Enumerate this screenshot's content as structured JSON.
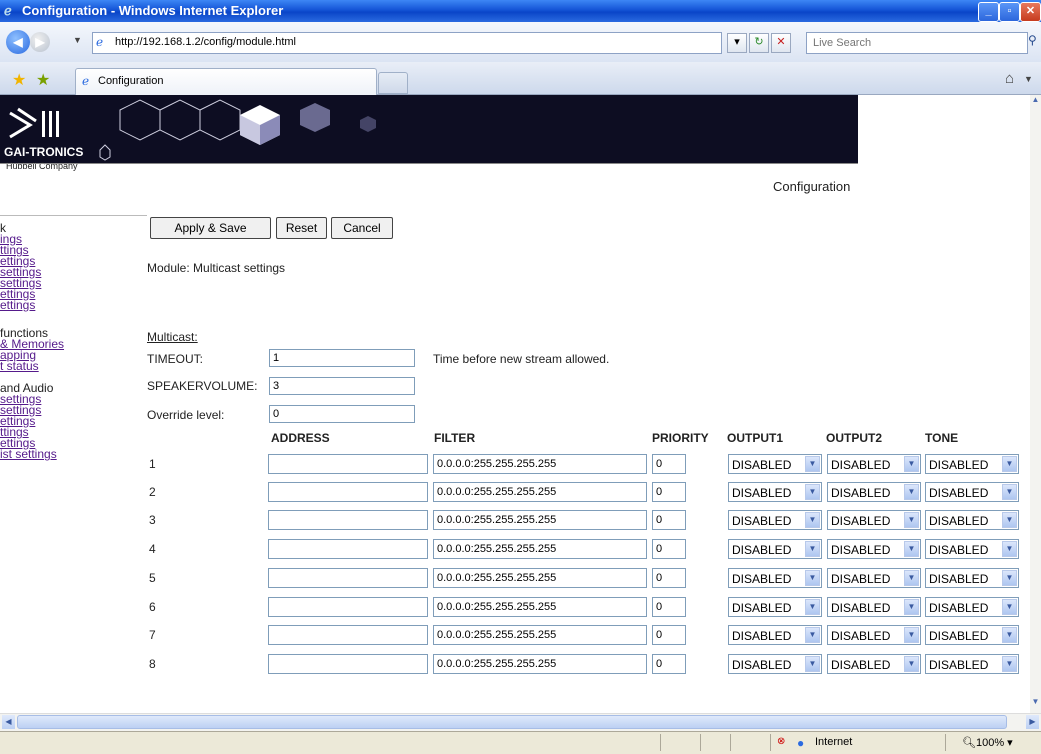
{
  "window": {
    "title": "Configuration - Windows Internet Explorer",
    "minimize": "_",
    "maximize": "▫",
    "close": "✕"
  },
  "addressbar": {
    "url": "http://192.168.1.2/config/module.html",
    "search_placeholder": "Live Search"
  },
  "tab": {
    "label": "Configuration"
  },
  "banner": {
    "brand": "GAI-TRONICS",
    "brand_sub": "Hubbell Company"
  },
  "page": {
    "title": "Configuration",
    "module": "Module: Multicast settings",
    "section_label": "Multicast:",
    "timeout_hint": "Time before new stream allowed."
  },
  "buttons": {
    "apply": "Apply & Save",
    "reset": "Reset",
    "cancel": "Cancel"
  },
  "sidebar": {
    "groups": [
      {
        "header": "k",
        "items": [
          "ings",
          "ttings",
          "ettings",
          " settings",
          "settings",
          "ettings",
          "ettings"
        ]
      },
      {
        "header": " functions",
        "items": [
          " & Memories",
          "apping",
          "t status"
        ]
      },
      {
        "header": " and Audio",
        "items": [
          "settings",
          "settings",
          "ettings",
          "ttings",
          "ettings",
          "ist settings"
        ]
      }
    ]
  },
  "fields": {
    "timeout": {
      "label": "TIMEOUT:",
      "value": "1"
    },
    "speakervolume": {
      "label": "SPEAKERVOLUME:",
      "value": "3"
    },
    "override": {
      "label": "Override level:",
      "value": "0"
    }
  },
  "table": {
    "columns": [
      "ADDRESS",
      "FILTER",
      "PRIORITY",
      "OUTPUT1",
      "OUTPUT2",
      "TONE"
    ],
    "rows": [
      {
        "num": "1",
        "address": "",
        "filter": "0.0.0.0:255.255.255.255",
        "priority": "0",
        "output1": "DISABLED",
        "output2": "DISABLED",
        "tone": "DISABLED"
      },
      {
        "num": "2",
        "address": "",
        "filter": "0.0.0.0:255.255.255.255",
        "priority": "0",
        "output1": "DISABLED",
        "output2": "DISABLED",
        "tone": "DISABLED"
      },
      {
        "num": "3",
        "address": "",
        "filter": "0.0.0.0:255.255.255.255",
        "priority": "0",
        "output1": "DISABLED",
        "output2": "DISABLED",
        "tone": "DISABLED"
      },
      {
        "num": "4",
        "address": "",
        "filter": "0.0.0.0:255.255.255.255",
        "priority": "0",
        "output1": "DISABLED",
        "output2": "DISABLED",
        "tone": "DISABLED"
      },
      {
        "num": "5",
        "address": "",
        "filter": "0.0.0.0:255.255.255.255",
        "priority": "0",
        "output1": "DISABLED",
        "output2": "DISABLED",
        "tone": "DISABLED"
      },
      {
        "num": "6",
        "address": "",
        "filter": "0.0.0.0:255.255.255.255",
        "priority": "0",
        "output1": "DISABLED",
        "output2": "DISABLED",
        "tone": "DISABLED"
      },
      {
        "num": "7",
        "address": "",
        "filter": "0.0.0.0:255.255.255.255",
        "priority": "0",
        "output1": "DISABLED",
        "output2": "DISABLED",
        "tone": "DISABLED"
      },
      {
        "num": "8",
        "address": "",
        "filter": "0.0.0.0:255.255.255.255",
        "priority": "0",
        "output1": "DISABLED",
        "output2": "DISABLED",
        "tone": "DISABLED"
      }
    ]
  },
  "statusbar": {
    "zone": "Internet",
    "zoom": "100%"
  }
}
